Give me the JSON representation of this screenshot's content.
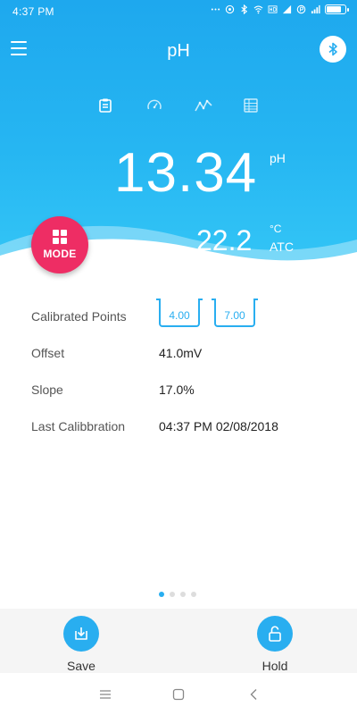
{
  "status_bar": {
    "time": "4:37 PM",
    "battery_level": 0.8,
    "icons": [
      "signal-dots-icon",
      "location-icon",
      "bluetooth-icon",
      "wifi-icon",
      "hd-icon",
      "signal-icon",
      "data-saver-icon",
      "signal-bars-icon",
      "battery-icon"
    ]
  },
  "app_bar": {
    "title": "pH",
    "menu_icon": "menu-icon",
    "bluetooth_icon": "bluetooth-icon"
  },
  "tabs": [
    {
      "icon": "clipboard-icon",
      "active": true
    },
    {
      "icon": "gauge-icon",
      "active": false
    },
    {
      "icon": "line-chart-icon",
      "active": false
    },
    {
      "icon": "table-icon",
      "active": false
    }
  ],
  "reading": {
    "ph_value": "13.34",
    "ph_unit": "pH",
    "temp_value": "22.2",
    "temp_unit": "°C",
    "temp_mode": "ATC"
  },
  "mode_button": {
    "label": "MODE"
  },
  "info": {
    "calibrated_points_label": "Calibrated Points",
    "calibrated_points": [
      "4.00",
      "7.00"
    ],
    "offset_label": "Offset",
    "offset_value": "41.0mV",
    "slope_label": "Slope",
    "slope_value": "17.0%",
    "last_calibration_label": "Last Calibbration",
    "last_calibration_value": "04:37 PM 02/08/2018"
  },
  "pager": {
    "count": 4,
    "active_index": 0
  },
  "actions": {
    "save_label": "Save",
    "hold_label": "Hold"
  },
  "colors": {
    "accent": "#29aef0",
    "mode_button": "#ee2d64",
    "header_top": "#1ea8ee",
    "header_bottom": "#34c6f6"
  }
}
